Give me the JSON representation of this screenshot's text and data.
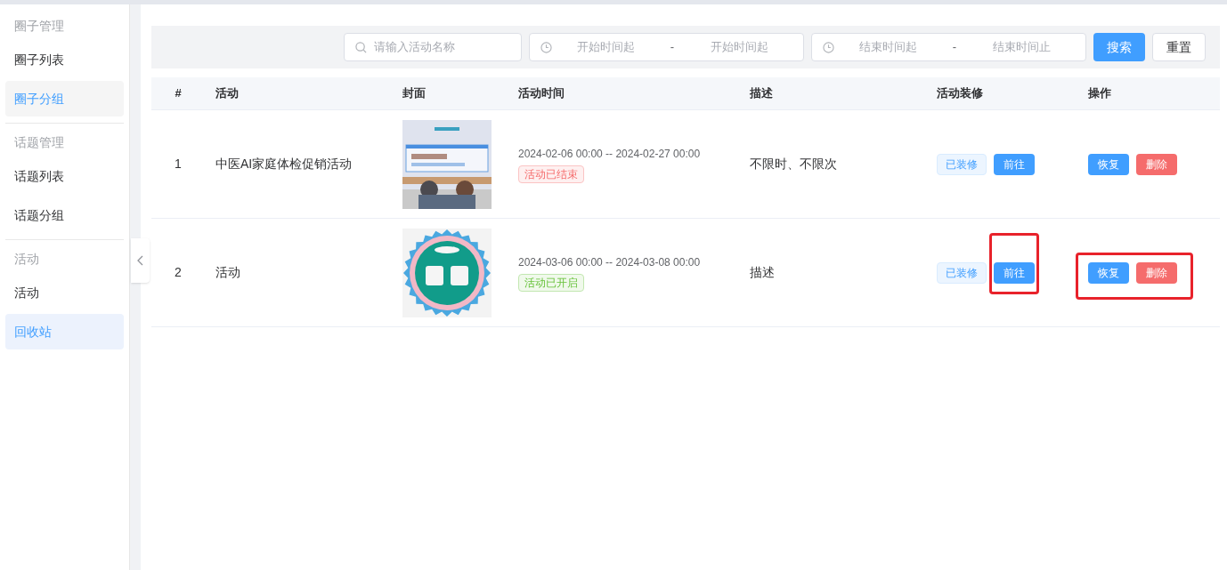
{
  "sidebar": {
    "groups": [
      {
        "title": "圈子管理",
        "items": [
          {
            "label": "圈子列表",
            "selected": false,
            "hovered": false
          },
          {
            "label": "圈子分组",
            "selected": false,
            "hovered": true
          }
        ]
      },
      {
        "title": "话题管理",
        "items": [
          {
            "label": "话题列表",
            "selected": false,
            "hovered": false
          },
          {
            "label": "话题分组",
            "selected": false,
            "hovered": false
          }
        ]
      },
      {
        "title": "活动",
        "items": [
          {
            "label": "活动",
            "selected": false,
            "hovered": false
          },
          {
            "label": "回收站",
            "selected": true,
            "hovered": false
          }
        ]
      }
    ]
  },
  "filters": {
    "search": {
      "placeholder": "请输入活动名称"
    },
    "start_range": {
      "from_placeholder": "开始时间起",
      "separator": "-",
      "to_placeholder": "开始时间起"
    },
    "end_range": {
      "from_placeholder": "结束时间起",
      "separator": "-",
      "to_placeholder": "结束时间止"
    },
    "search_button": "搜索",
    "reset_button": "重置"
  },
  "table": {
    "columns": [
      "#",
      "活动",
      "封面",
      "活动时间",
      "描述",
      "活动装修",
      "操作"
    ],
    "rows": [
      {
        "index": "1",
        "name": "中医AI家庭体检促销活动",
        "time": "2024-02-06 00:00 -- 2024-02-27 00:00",
        "status": {
          "text": "活动已结束",
          "kind": "ended"
        },
        "description": "不限时、不限次",
        "renovation_tag": "已装修",
        "go_button": "前往",
        "go_highlighted": false,
        "restore_button": "恢复",
        "delete_button": "删除",
        "actions_highlighted": false
      },
      {
        "index": "2",
        "name": "活动",
        "time": "2024-03-06 00:00 -- 2024-03-08 00:00",
        "status": {
          "text": "活动已开启",
          "kind": "active"
        },
        "description": "描述",
        "renovation_tag": "已装修",
        "go_button": "前往",
        "go_highlighted": true,
        "restore_button": "恢复",
        "delete_button": "删除",
        "actions_highlighted": true
      }
    ]
  }
}
